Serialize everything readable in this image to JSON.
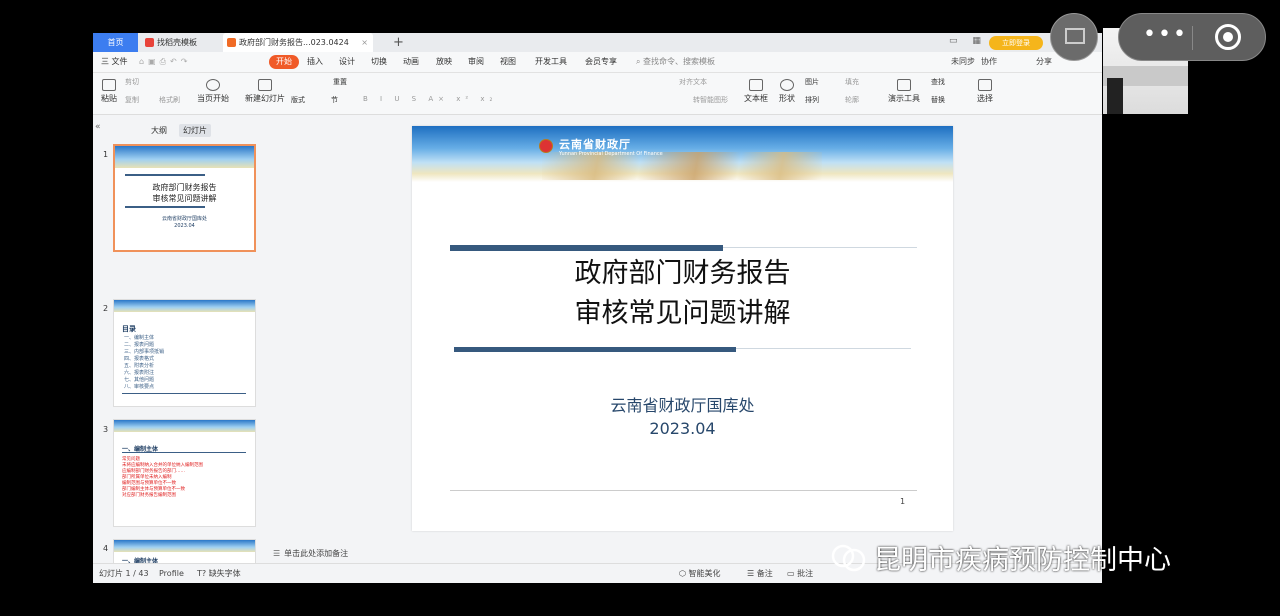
{
  "tabs": {
    "home": "首页",
    "t1": "找稻壳模板",
    "t2": "政府部门财务报告...023.0424"
  },
  "login_label": "立即登录",
  "menu": {
    "file": "三 文件",
    "items": [
      "开始",
      "插入",
      "设计",
      "切换",
      "动画",
      "放映",
      "审阅",
      "视图",
      "开发工具",
      "会员专享"
    ],
    "search": "查找命令、搜索模板",
    "sync": "未同步",
    "collab": "协作",
    "share": "分享"
  },
  "ribbon": {
    "paste": "粘贴",
    "cut": "剪切",
    "copy": "复制",
    "format": "格式刷",
    "start_show": "当页开始",
    "new_slide": "新建幻灯片",
    "layout": "版式",
    "section": "节",
    "reset": "重置",
    "smart": "转智能图形",
    "textbox": "文本框",
    "shape": "形状",
    "image": "图片",
    "arrange": "排列",
    "fill": "填充",
    "outline": "轮廓",
    "present_tools": "演示工具",
    "find": "查找",
    "replace": "替换",
    "select": "选择",
    "text_effect": "对齐文本"
  },
  "panel": {
    "outline_tab": "大纲",
    "slides_tab": "幻灯片"
  },
  "thumbs": {
    "t1_title_1": "政府部门财务报告",
    "t1_title_2": "审核常见问题讲解",
    "t1_org": "云南省财政厅国库处",
    "t1_date": "2023.04",
    "t2_toc": "目录",
    "t2_items": [
      "一、编制主体",
      "二、报表问题",
      "三、内部事项抵销",
      "四、报表格式",
      "五、附表分析",
      "六、报表附注",
      "七、其他问题",
      "八、审核要点"
    ],
    "t3_section": "一、编制主体",
    "t3_lines": [
      "常见问题",
      "未将应编制纳入合并的单位纳入编制范围",
      "应编制部门财务报告的部门……",
      "部门所属单位未纳入编制",
      "编制范围与预算单位不一致",
      "部门编制主体与预算单位不一致",
      "对应部门财务报告编制范围"
    ],
    "t4_section": "一、编制主体"
  },
  "slide": {
    "dept_cn": "云南省财政厅",
    "dept_en": "Yunnan Provincial Department Of Finance",
    "title_line1": "政府部门财务报告",
    "title_line2": "审核常见问题讲解",
    "org": "云南省财政厅国库处",
    "date": "2023.04",
    "page_number": "1"
  },
  "notes_placeholder": "单击此处添加备注",
  "status": {
    "slide_counter": "幻灯片 1 / 43",
    "theme": "Profile",
    "missing_font": "缺失字体",
    "smart_beautify": "智能美化",
    "notes_btn": "备注",
    "comments_btn": "批注"
  },
  "watermark": "昆明市疾病预防控制中心",
  "thumb_numbers": [
    "1",
    "2",
    "3",
    "4"
  ],
  "colors": {
    "accent": "#f05a28",
    "home_tab": "#3c7df0",
    "title_bar": "#36597e",
    "org_text": "#27476b"
  }
}
